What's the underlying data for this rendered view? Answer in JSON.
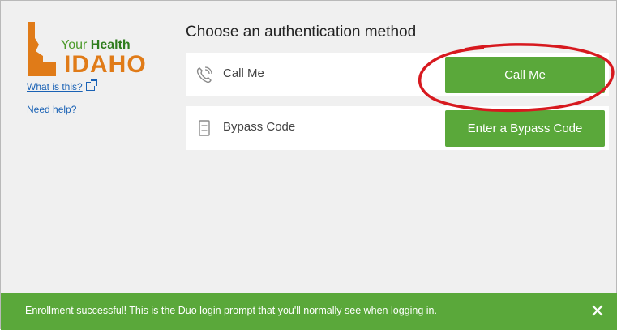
{
  "brand": {
    "logo_line1_prefix": "Your ",
    "logo_line1_strong": "Health",
    "logo_line2": "IDAHO",
    "what_link": "What is this?",
    "help_link": "Need help?"
  },
  "main": {
    "heading": "Choose an authentication method",
    "methods": [
      {
        "label": "Call Me",
        "button": "Call Me",
        "icon": "phone-icon"
      },
      {
        "label": "Bypass Code",
        "button": "Enter a Bypass Code",
        "icon": "passcode-icon"
      }
    ]
  },
  "banner": {
    "message": "Enrollment successful! This is the Duo login prompt that you'll normally see when logging in.",
    "close": "✕"
  },
  "colors": {
    "accent_green": "#5aa83a",
    "idaho_orange": "#e07b18",
    "annotation_red": "#d7191f"
  }
}
